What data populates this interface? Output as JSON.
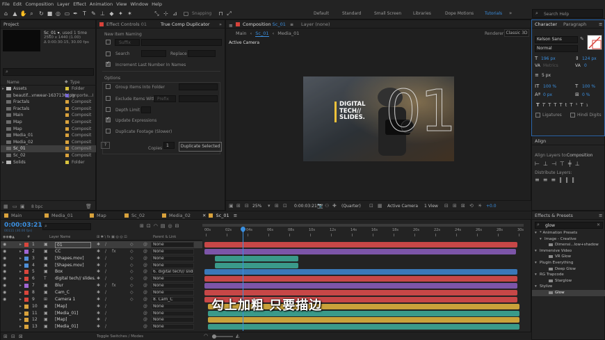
{
  "menu": [
    "File",
    "Edit",
    "Composition",
    "Layer",
    "Effect",
    "Animation",
    "View",
    "Window",
    "Help"
  ],
  "toolbar": {
    "snapping": "Snapping",
    "workspaces": [
      "Default",
      "Standard",
      "Small Screen",
      "Libraries",
      "Dope Motions",
      "Tutorials"
    ],
    "active_workspace": "Tutorials",
    "search_placeholder": "Search Help"
  },
  "project": {
    "title": "Project",
    "comp_name": "Sc_01",
    "comp_used": ", used 1 time",
    "comp_size": "2560 x 1440 (1.00)",
    "comp_dur": "Δ 0:00:30:15, 30.00 fps",
    "col_name": "Name",
    "col_type": "Type",
    "items": [
      {
        "name": "Assets",
        "type": "Folder",
        "color": "#d9c23c",
        "folder": true
      },
      {
        "name": "beautif...vnwear-1637136.jpg",
        "type": "Importe...I",
        "color": "#7a6ad9",
        "folder": false
      },
      {
        "name": "Fractals",
        "type": "Composit",
        "color": "#d9a23c",
        "folder": false
      },
      {
        "name": "Fractals",
        "type": "Composit",
        "color": "#d9a23c",
        "folder": false
      },
      {
        "name": "Main",
        "type": "Composit",
        "color": "#d9a23c",
        "folder": false
      },
      {
        "name": "Map",
        "type": "Composit",
        "color": "#d9a23c",
        "folder": false
      },
      {
        "name": "Map",
        "type": "Composit",
        "color": "#d9a23c",
        "folder": false
      },
      {
        "name": "Media_01",
        "type": "Composit",
        "color": "#d9a23c",
        "folder": false
      },
      {
        "name": "Media_02",
        "type": "Composit",
        "color": "#d9a23c",
        "folder": false
      },
      {
        "name": "Sc_01",
        "type": "Composit",
        "color": "#d9a23c",
        "folder": false
      },
      {
        "name": "Sc_02",
        "type": "Composit",
        "color": "#d9a23c",
        "folder": false
      },
      {
        "name": "Solids",
        "type": "Folder",
        "color": "#d9c23c",
        "folder": true
      }
    ],
    "bpc": "8 bpc"
  },
  "effect_controls": {
    "tab1": "Effect Controls",
    "tab1_val": "01",
    "tab2": "True Comp Duplicator"
  },
  "duplicator": {
    "new_item_naming": "New Item Naming",
    "suffix": "Suffix",
    "search": "Search",
    "replace": "Replace",
    "increment": "Increment Last Number In Names",
    "options": "Options",
    "group": "Group Items Into Folder",
    "exclude": "Exclude Items With",
    "exclude_val": "Prefix",
    "depth": "Depth Limit",
    "update": "Update Expressions",
    "dup_footage": "Duplicate Footage (Slower)",
    "help": "?",
    "copies": "Copies",
    "copies_val": "1",
    "dup_button": "Duplicate Selected"
  },
  "composition": {
    "tab": "Composition",
    "tab_val": "Sc_01",
    "layer_tab": "Layer (none)",
    "crumbs": [
      "Main",
      "Sc_01",
      "Media_01"
    ],
    "renderer_label": "Renderer:",
    "renderer": "Classic 3D",
    "camera_label": "Active Camera",
    "preview_text": [
      "DIGITAL",
      "TECH//",
      "SLIDES."
    ],
    "big_number": "01",
    "zoom": "25%",
    "timecode": "0:00:03:21",
    "quality": "(Quarter)",
    "camera": "Active Camera",
    "view": "1 View",
    "offset": "+0.0"
  },
  "character": {
    "tab": "Character",
    "tab2": "Paragraph",
    "font": "Kelson Sans",
    "style": "Normal",
    "size": "196 px",
    "leading": "124 px",
    "kerning": "Metrics",
    "tracking": "0",
    "stroke": "5 px",
    "vscale": "100 %",
    "hscale": "100 %",
    "baseline": "0 px",
    "tsume": "0 %",
    "ligatures": "Ligatures",
    "hindi": "Hindi Digits"
  },
  "align": {
    "title": "Align",
    "align_to_label": "Align Layers to:",
    "align_to": "Composition",
    "distribute": "Distribute Layers:"
  },
  "effects": {
    "title": "Effects & Presets",
    "search": "glow",
    "tree": [
      {
        "label": "* Animation Presets",
        "indent": 0
      },
      {
        "label": "Image - Creative",
        "indent": 1
      },
      {
        "label": "Dimensi...low+shadow",
        "indent": 2
      },
      {
        "label": "Immersive Video",
        "indent": 0
      },
      {
        "label": "VR Glow",
        "indent": 2
      },
      {
        "label": "Plugin Everything",
        "indent": 0
      },
      {
        "label": "Deep Glow",
        "indent": 2
      },
      {
        "label": "RG Trapcode",
        "indent": 0
      },
      {
        "label": "Starglow",
        "indent": 2
      },
      {
        "label": "Stylize",
        "indent": 0
      },
      {
        "label": "Glow",
        "indent": 2
      }
    ]
  },
  "timeline": {
    "tabs": [
      {
        "label": "Main",
        "color": "#d9a23c"
      },
      {
        "label": "Media_01",
        "color": "#d9a23c"
      },
      {
        "label": "Map",
        "color": "#d9a23c"
      },
      {
        "label": "Sc_02",
        "color": "#d9a23c"
      },
      {
        "label": "Media_02",
        "color": "#d9a23c"
      },
      {
        "label": "Sc_01",
        "color": "#d9a23c",
        "active": true
      }
    ],
    "timecode": "0:00:03:21",
    "frames": "00111 (30.00 fps)",
    "col_layer": "Layer Name",
    "col_parent": "Parent & Link",
    "ticks": [
      "00s",
      "02s",
      "04s",
      "06s",
      "08s",
      "10s",
      "12s",
      "14s",
      "16s",
      "18s",
      "20s",
      "22s",
      "24s",
      "26s",
      "28s",
      "30s"
    ],
    "layers": [
      {
        "num": "1",
        "name": "01",
        "color": "#d9463c",
        "parent": "None"
      },
      {
        "num": "2",
        "name": "CC",
        "color": "#a066d3",
        "parent": "None"
      },
      {
        "num": "3",
        "name": "[Shapes.mov]",
        "color": "#4f8fd8",
        "parent": "None"
      },
      {
        "num": "4",
        "name": "[Shapes.mov]",
        "color": "#4f8fd8",
        "parent": "None"
      },
      {
        "num": "5",
        "name": "Box",
        "color": "#d9463c",
        "parent": "6. digital tech// slides"
      },
      {
        "num": "6",
        "name": "digital tech// slides.",
        "color": "#d9463c",
        "parent": "None"
      },
      {
        "num": "7",
        "name": "Blur",
        "color": "#a066d3",
        "parent": "None"
      },
      {
        "num": "8",
        "name": "Cam_C",
        "color": "#d9463c",
        "parent": "None"
      },
      {
        "num": "9",
        "name": "Camera 1",
        "color": "#d9463c",
        "parent": "8. Cam_C"
      },
      {
        "num": "10",
        "name": "[Map]",
        "color": "#d9a23c",
        "parent": "None"
      },
      {
        "num": "11",
        "name": "[Media_01]",
        "color": "#d9a23c",
        "parent": "None"
      },
      {
        "num": "12",
        "name": "[Map]",
        "color": "#d9a23c",
        "parent": "None"
      },
      {
        "num": "13",
        "name": "[Media_01]",
        "color": "#d9a23c",
        "parent": "None"
      }
    ],
    "footer": "Toggle Switches / Modes",
    "subtitle": "勾上加粗 只要描边"
  }
}
